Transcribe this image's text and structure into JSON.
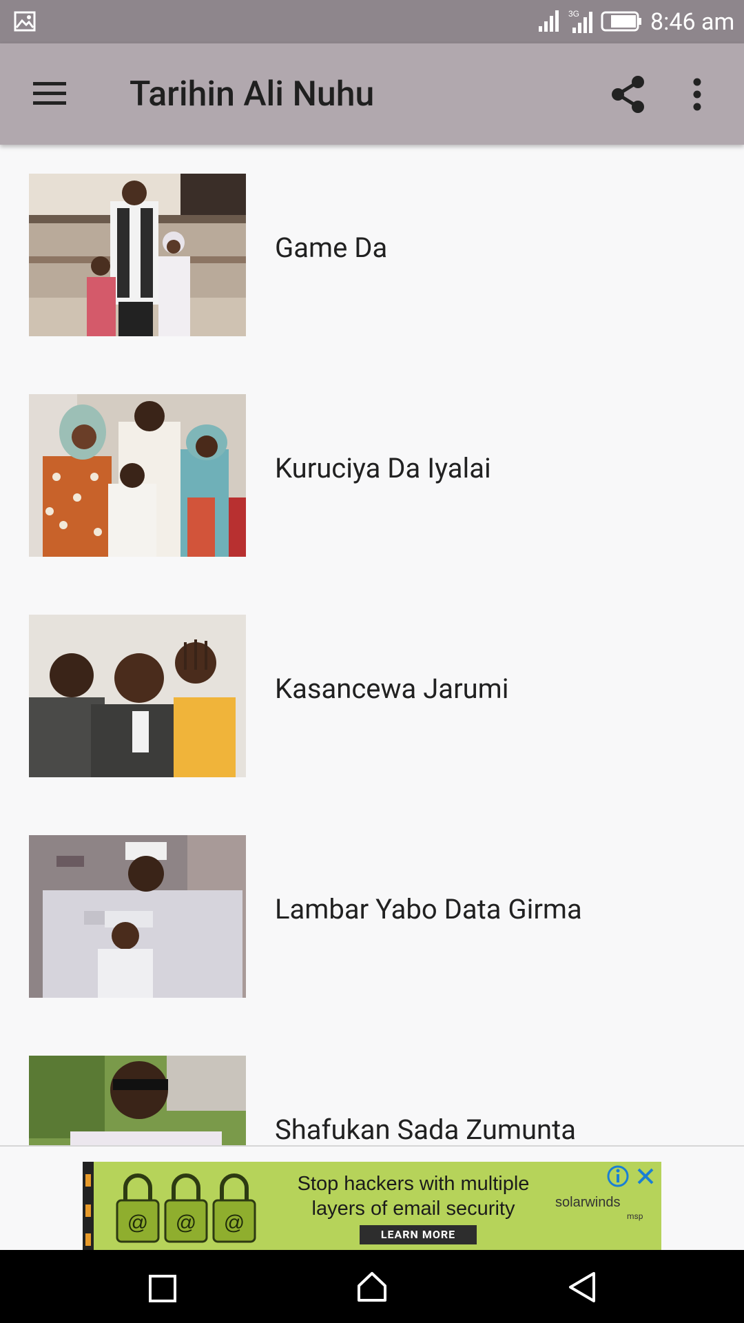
{
  "status_bar": {
    "time": "8:46 am",
    "network_label": "3G",
    "icons": [
      "gallery-icon",
      "signal-icon",
      "signal-3g-icon",
      "battery-icon"
    ]
  },
  "app_bar": {
    "title": "Tarihin Ali Nuhu",
    "icons": [
      "menu-icon",
      "share-icon",
      "more-vert-icon"
    ]
  },
  "list": {
    "items": [
      {
        "label": "Game Da"
      },
      {
        "label": "Kuruciya Da Iyalai"
      },
      {
        "label": "Kasancewa Jarumi"
      },
      {
        "label": "Lambar Yabo Data Girma"
      },
      {
        "label": "Shafukan Sada Zumunta"
      }
    ]
  },
  "ad": {
    "headline_line1": "Stop hackers with multiple",
    "headline_line2": "layers of email security",
    "cta": "LEARN MORE",
    "brand": "solarwinds",
    "brand_sub": "msp",
    "colors": {
      "background": "#b6d35a",
      "cta": "#2d2d2d"
    }
  },
  "colors": {
    "status_bar": "#8e868c",
    "app_bar": "#b1a8ae",
    "background": "#f8f8f9",
    "nav_bar": "#000000"
  }
}
